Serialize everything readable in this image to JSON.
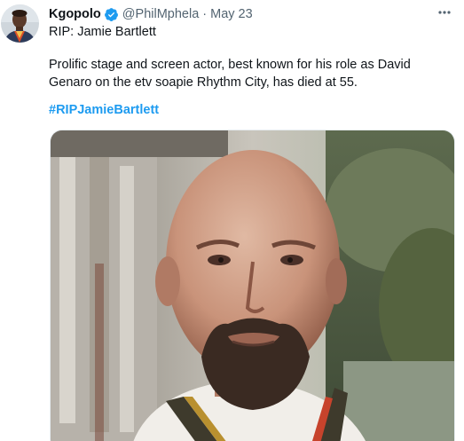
{
  "tweet": {
    "display_name": "Kgopolo",
    "handle": "@PhilMphela",
    "separator": "·",
    "date": "May 23",
    "first_line": "RIP: Jamie Bartlett",
    "body": "Prolific stage and screen actor, best known for his role as David Genaro on the etv soapie Rhythm City,  has died at 55.",
    "hashtag": "#RIPJamieBartlett"
  },
  "icons": {
    "verified": "verified-badge-icon",
    "more": "more-options-icon"
  },
  "colors": {
    "link": "#1d9bf0",
    "verified": "#1d9bf0",
    "secondary_text": "#536471",
    "primary_text": "#0f1419"
  }
}
